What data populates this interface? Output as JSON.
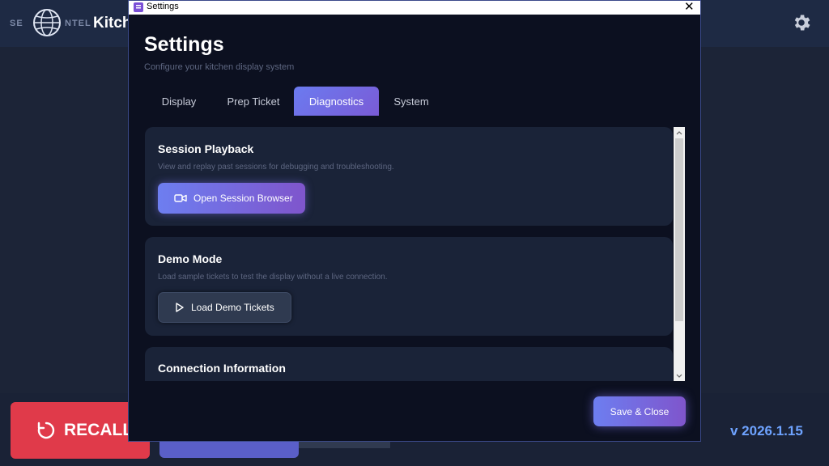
{
  "app": {
    "logo_left": "SE",
    "logo_right": "NTEL",
    "title": "Kitch",
    "version": "v  2026.1.15",
    "recall_label": "RECALL"
  },
  "window": {
    "title": "Settings",
    "close_glyph": "✕"
  },
  "settings": {
    "title": "Settings",
    "subtitle": "Configure your kitchen display system",
    "tabs": [
      {
        "label": "Display",
        "active": false
      },
      {
        "label": "Prep Ticket",
        "active": false
      },
      {
        "label": "Diagnostics",
        "active": true
      },
      {
        "label": "System",
        "active": false
      }
    ],
    "sections": [
      {
        "title": "Session Playback",
        "description": "View and replay past sessions for debugging and troubleshooting.",
        "button_label": "Open Session Browser",
        "button_icon": "video-icon"
      },
      {
        "title": "Demo Mode",
        "description": "Load sample tickets to test the display without a live connection.",
        "button_label": "Load Demo Tickets",
        "button_icon": "play-icon"
      },
      {
        "title": "Connection Information"
      }
    ],
    "save_label": "Save & Close"
  },
  "colors": {
    "accent_start": "#6d7ef0",
    "accent_end": "#7f55cc",
    "recall": "#e03a4a",
    "version": "#6ea3ff"
  }
}
